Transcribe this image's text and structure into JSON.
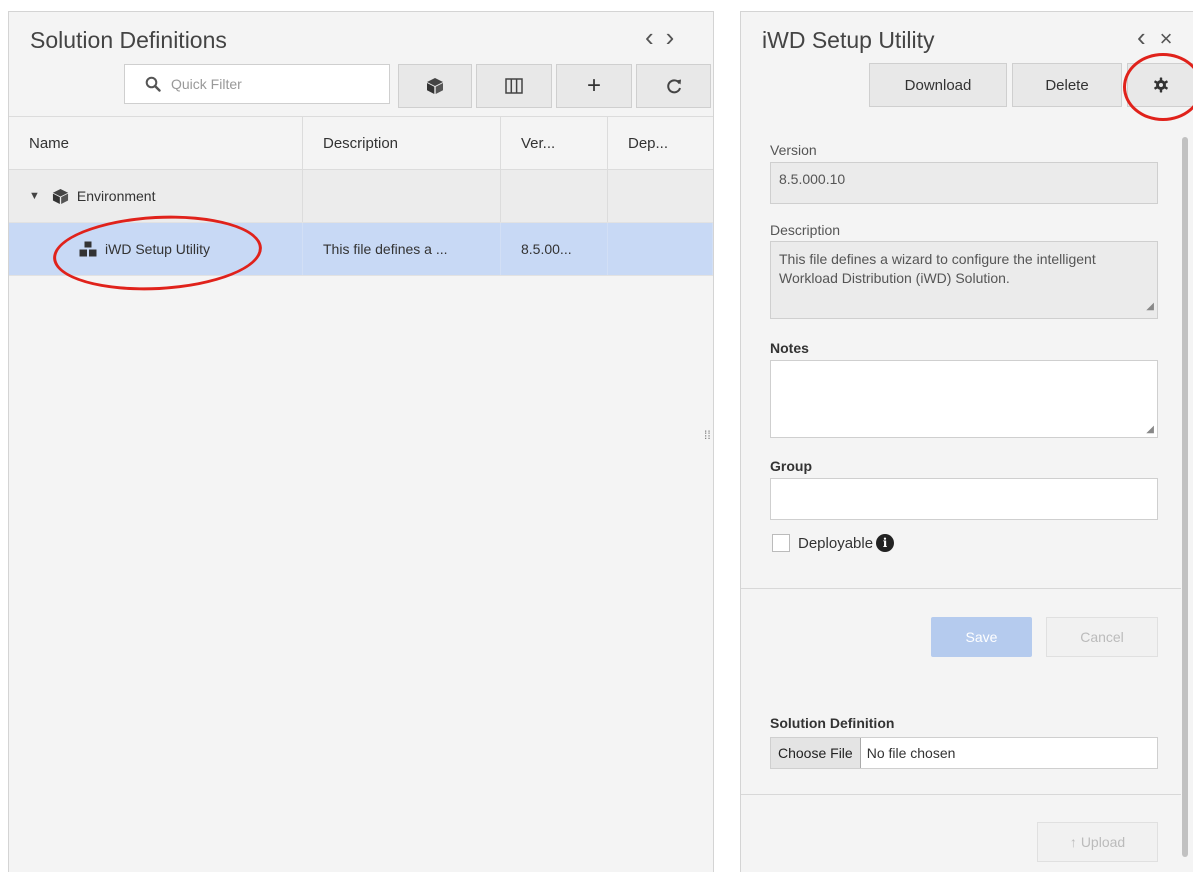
{
  "left_panel": {
    "title": "Solution Definitions",
    "nav_prev": "‹",
    "nav_next": "›",
    "search_placeholder": "Quick Filter",
    "toolbar": {
      "add_label": "+"
    },
    "columns": [
      "Name",
      "Description",
      "Ver...",
      "Dep..."
    ],
    "rows": [
      {
        "name": "Environment",
        "description": "",
        "version": "",
        "deploy": ""
      },
      {
        "name": "iWD Setup Utility",
        "description": "This file defines a ...",
        "version": "8.5.00...",
        "deploy": ""
      }
    ]
  },
  "right_panel": {
    "title": "iWD Setup Utility",
    "nav_prev": "‹",
    "close": "×",
    "download_label": "Download",
    "delete_label": "Delete",
    "version_label": "Version",
    "version_value": "8.5.000.10",
    "description_label": "Description",
    "description_value": "This file defines a wizard to configure the intelligent Workload Distribution (iWD) Solution.",
    "notes_label": "Notes",
    "notes_value": "",
    "group_label": "Group",
    "group_value": "",
    "deployable_label": "Deployable",
    "info_glyph": "i",
    "save_label": "Save",
    "cancel_label": "Cancel",
    "solution_definition_label": "Solution Definition",
    "choose_file_label": "Choose File",
    "no_file_label": "No file chosen",
    "upload_label": "Upload",
    "upload_arrow": "↑"
  },
  "colors": {
    "selected_row": "#c8d9f5",
    "annotation_circle": "#e0221b",
    "save_disabled": "#b5cbee"
  },
  "icons": [
    "search-icon",
    "package-icon",
    "columns-icon",
    "plus-icon",
    "refresh-icon",
    "cube-icon",
    "solution-icon",
    "gear-icon",
    "info-icon",
    "upload-arrow-icon"
  ]
}
